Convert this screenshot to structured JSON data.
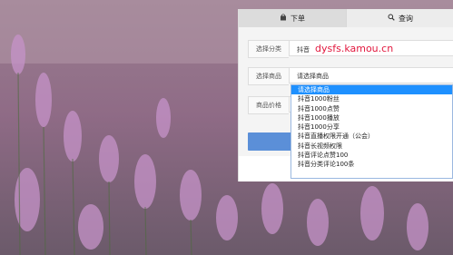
{
  "tabs": [
    {
      "label": "下单",
      "icon": "shopping-bag-icon"
    },
    {
      "label": "查询",
      "icon": "search-icon"
    }
  ],
  "form": {
    "category_label": "选择分类",
    "category_value": "抖音",
    "watermark": "dysfs.kamou.cn",
    "product_label": "选择商品",
    "product_value": "请选择商品",
    "price_label": "商品价格"
  },
  "dropdown": {
    "options": [
      "请选择商品",
      "抖音1000粉丝",
      "抖音1000点赞",
      "抖音1000播放",
      "抖音1000分享",
      "抖音直播权限开通（公会）",
      "抖音长视频权限",
      "抖音评论点赞100",
      "抖音分类评论100条"
    ],
    "selected_index": 0
  },
  "colors": {
    "accent": "#1e90ff",
    "watermark": "#e2183e",
    "submit_button": "#5b8fd8"
  }
}
